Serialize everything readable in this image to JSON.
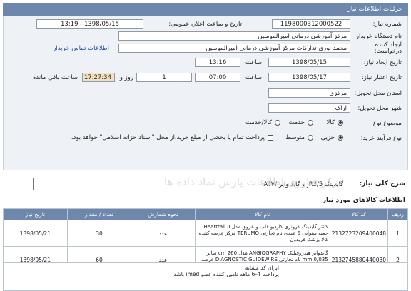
{
  "header": {
    "title": "جزئیات اطلاعات نیاز"
  },
  "form": {
    "need_number": {
      "label": "شماره نیاز:",
      "value": "1198000312000522"
    },
    "announce": {
      "label": "تاریخ و ساعت اعلان عمومی:",
      "value": "1398/05/15 - 13:19"
    },
    "device": {
      "label": "نام دستگاه خریدار:",
      "value": "مرکز آموزشی درمانی امیرالمومنین"
    },
    "requester": {
      "label": "ایجاد کننده درخواست:",
      "value": "محمد نوری تدارکات مرکز آموزشی درمانی امیرالمومنین",
      "contact_link": "اطلاعات تماس خریدار"
    },
    "created": {
      "label": "تاریخ ایجاد نیاز:",
      "date": "1398/05/15",
      "time_label": "ساعت",
      "time": "13:16"
    },
    "deadline": {
      "label": "تاریخ اعتبار نیاز:",
      "date": "1398/05/17",
      "time_label": "ساعت",
      "time": "07:00",
      "days": "1",
      "days_label": "روز و",
      "remaining": "17:27:34",
      "remaining_label": "ساعت باقی مانده"
    },
    "province": {
      "label": "استان محل تحویل:",
      "value": "مرکزی"
    },
    "city": {
      "label": "شهر محل تحویل:",
      "value": "اراک"
    },
    "subject": {
      "label": "موضوع نوع:",
      "options": [
        "کالا",
        "خدمت",
        "کالا/خدمت"
      ],
      "selected": "کالا"
    },
    "purchase_type": {
      "label": "نوع فرآیند خرید:",
      "options": [
        "جزیی",
        "متوسط"
      ],
      "selected": "جزیی",
      "payment_note": "پرداخت تمام یا بخشی از مبلغ خرید،از محل \"اسناد خزانه اسلامی\" خواهد بود."
    }
  },
  "summary": {
    "label": "شرح کلی نیاز:",
    "value": "گایدینگ JR3/5 و گاید وایر ATW",
    "watermark": "مرکز فناوری اطلاعات پارس نماد داده ها"
  },
  "items_section": {
    "title": "اطلاعات کالاهای مورد نیاز",
    "columns": [
      "ردیف",
      "کد کالا",
      "نام کالا",
      "نحوه شمارش",
      "تعداد / مقدار",
      "تاریخ نیاز"
    ],
    "rows": [
      {
        "row": "1",
        "code": "2132723209400048",
        "name": "کاتتر گایدینگ کرونری کاردیو قلب و عروق مدل Heartrail II جعبه مقوایی 5 عددی نام تجارتی TERUMO مرکز عرضه کننده کالا پزشک فریدون",
        "unit": "عدد",
        "qty": "30",
        "date": "1398/05/21"
      },
      {
        "row": "2",
        "code": "2132745880440030",
        "name": "گایدوایر هیدروفیلیک ANGIOGRAPHY مدل cm 260 سایز mm 0/035 نام تجارتی DIAGNOSTIC GUIDEWIRE عرضه کننده مهندسی پزشکی مادر طب پارس",
        "unit": "عدد",
        "qty": "60",
        "date": "1398/05/21"
      }
    ]
  },
  "notes": {
    "lines": [
      "ایران کد مشابه",
      "پرداخت 4-6 ماهه تامین کننده عضو imed باشد"
    ]
  }
}
